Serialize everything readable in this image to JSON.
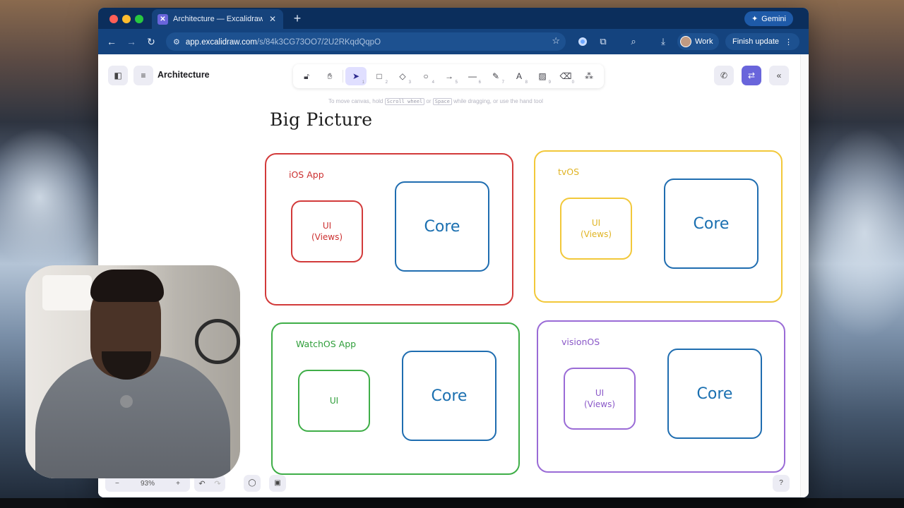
{
  "browser": {
    "tab_title": "Architecture — Excalidraw Pl",
    "tab_icon": "excalidraw-icon",
    "new_tab_label": "+",
    "gemini_label": "Gemini",
    "url_site": "app.excalidraw.com",
    "url_path": "/s/84k3CG73OO7/2U2RKqdQqpO",
    "profile_label": "Work",
    "finish_update_label": "Finish update"
  },
  "app": {
    "document_title": "Architecture",
    "tools": [
      {
        "icon": "lock-icon",
        "key": ""
      },
      {
        "icon": "hand-icon",
        "key": ""
      },
      {
        "icon": "selection-icon",
        "key": "1",
        "active": true
      },
      {
        "icon": "rectangle-icon",
        "key": "2"
      },
      {
        "icon": "diamond-icon",
        "key": "3"
      },
      {
        "icon": "ellipse-icon",
        "key": "4"
      },
      {
        "icon": "arrow-icon",
        "key": "5"
      },
      {
        "icon": "line-icon",
        "key": "6"
      },
      {
        "icon": "draw-icon",
        "key": "7"
      },
      {
        "icon": "text-icon",
        "key": "8"
      },
      {
        "icon": "image-icon",
        "key": "9"
      },
      {
        "icon": "eraser-icon",
        "key": "0"
      },
      {
        "icon": "more-tools-icon",
        "key": ""
      }
    ],
    "hint": {
      "prefix": "To move canvas, hold",
      "key1": "Scroll wheel",
      "middle": "or",
      "key2": "Space",
      "suffix": "while dragging, or use the hand tool"
    },
    "zoom_level": "93%",
    "zoom_minus": "−",
    "zoom_plus": "+"
  },
  "canvas": {
    "title": "Big Picture",
    "groups": [
      {
        "label": "iOS App",
        "ui_label": "UI\n(Views)",
        "core_label": "Core",
        "color": "#d23a3a"
      },
      {
        "label": "tvOS",
        "ui_label": "UI\n(Views)",
        "core_label": "Core",
        "color": "#f2c83a"
      },
      {
        "label": "WatchOS App",
        "ui_label": "UI",
        "core_label": "Core",
        "color": "#3fae48"
      },
      {
        "label": "visionOS",
        "ui_label": "UI\n(Views)",
        "core_label": "Core",
        "color": "#9a6bd6"
      }
    ]
  }
}
